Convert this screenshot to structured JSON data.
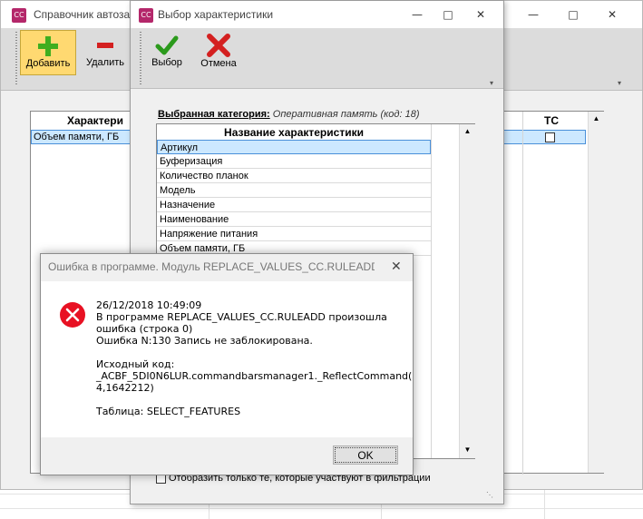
{
  "main_window": {
    "title": "Справочник автоза",
    "icon_text": "CC",
    "toolbar": {
      "add_label": "Добавить",
      "delete_label": "Удалить"
    },
    "grid": {
      "col1_header": "Характери",
      "col2_header": "ТС",
      "row1_text": "Объем памяти, ГБ"
    }
  },
  "select_dialog": {
    "title": "Выбор характеристики",
    "icon_text": "CC",
    "toolbar": {
      "select_label": "Выбор",
      "cancel_label": "Отмена"
    },
    "category_label": "Выбранная категория:",
    "category_value": "Оперативная память (код: 18)",
    "column_header": "Название характеристики",
    "rows": [
      "Артикул",
      "Буферизация",
      "Количество планок",
      "Модель",
      "Назначение",
      "Наименование",
      "Напряжение питания",
      "Объем памяти, ГБ"
    ],
    "filter_checkbox_label": "Отобразить только те, которые участвуют в фильтрации"
  },
  "error_dialog": {
    "title": "Ошибка в программе. Модуль REPLACE_VALUES_CC.RULEADD вып...",
    "close_symbol": "✕",
    "message_lines": [
      "26/12/2018 10:49:09",
      "В программе REPLACE_VALUES_CC.RULEADD произошла",
      "ошибка (строка 0)",
      "Ошибка N:130 Запись не заблокирована.",
      "",
      "Исходный код:",
      "_ACBF_5DI0N6LUR.commandbarsmanager1._ReflectCommand(",
      "4,1642212)",
      "",
      "Таблица: SELECT_FEATURES"
    ],
    "ok_label": "OK"
  },
  "icons": {
    "add": "plus-icon",
    "delete": "minus-icon",
    "select": "checkmark-icon",
    "cancel": "x-icon",
    "error": "error-icon"
  },
  "colors": {
    "app_icon": "#b4276a",
    "selected_row": "#cce8ff",
    "add_button_bg": "#ffd971",
    "error_red": "#e81123",
    "check_green": "#2b9a1c",
    "cancel_red": "#d42020"
  }
}
